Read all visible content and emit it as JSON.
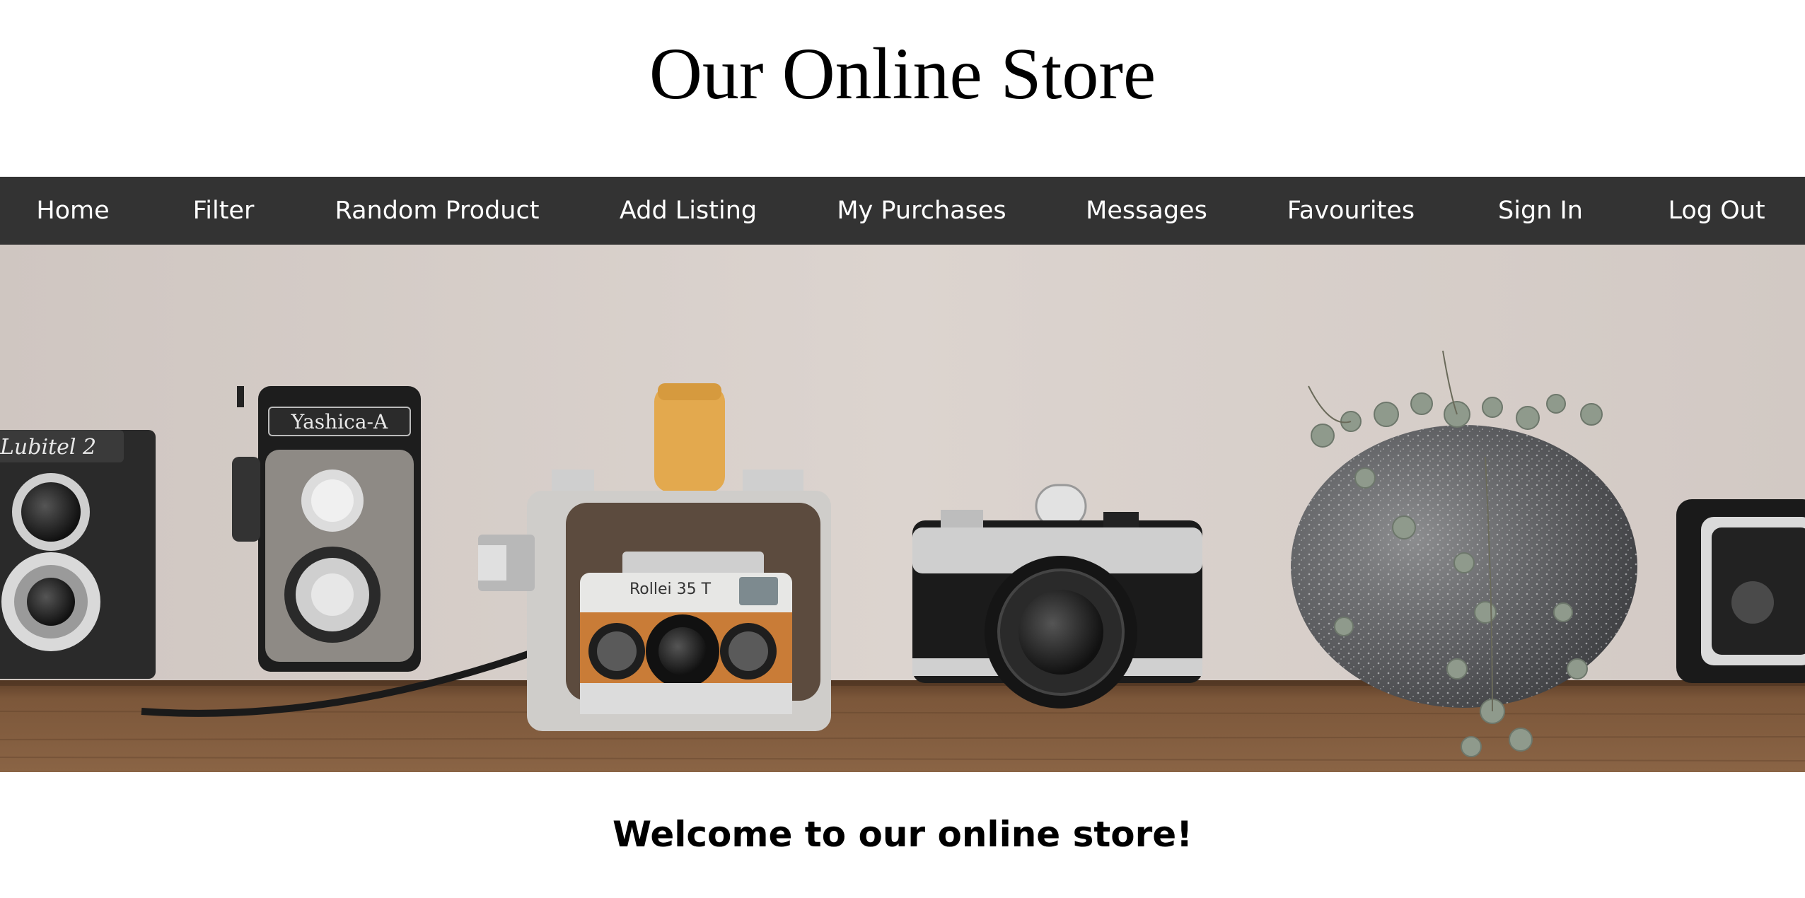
{
  "header": {
    "title": "Our Online Store"
  },
  "nav": {
    "items": [
      {
        "label": "Home"
      },
      {
        "label": "Filter"
      },
      {
        "label": "Random Product"
      },
      {
        "label": "Add Listing"
      },
      {
        "label": "My Purchases"
      },
      {
        "label": "Messages"
      },
      {
        "label": "Favourites"
      },
      {
        "label": "Sign In"
      },
      {
        "label": "Log Out"
      }
    ]
  },
  "hero": {
    "camera_labels": [
      "Lubitel 2",
      "Yashica-A",
      "Rollei 35 T"
    ]
  },
  "main": {
    "welcome_heading": "Welcome to our online store!"
  },
  "colors": {
    "navbar_bg": "#333333",
    "nav_text": "#ffffff",
    "wall": "#d6ceca",
    "shelf": "#7a5537"
  }
}
